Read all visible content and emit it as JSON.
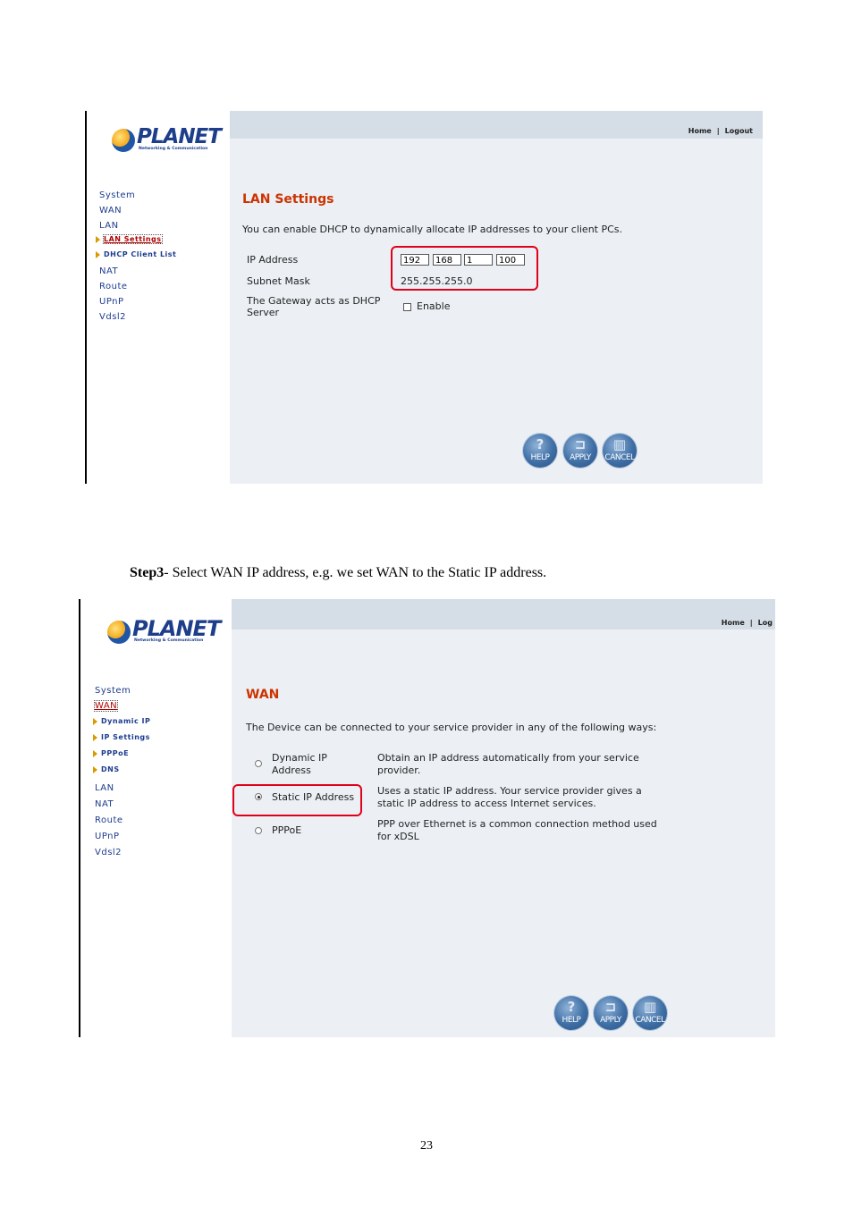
{
  "screen1": {
    "logo": {
      "word": "PLANET",
      "tagline": "Networking & Communication"
    },
    "top_links": {
      "home": "Home",
      "sep": "|",
      "logout": "Logout"
    },
    "nav": {
      "system": "System",
      "wan": "WAN",
      "lan": "LAN",
      "lan_settings": "LAN Settings",
      "dhcp_client_list": "DHCP Client List",
      "nat": "NAT",
      "route": "Route",
      "upnp": "UPnP",
      "vdsl2": "Vdsl2"
    },
    "title": "LAN Settings",
    "description": "You can enable DHCP to dynamically allocate IP addresses to your client PCs.",
    "ip_label": "IP Address",
    "ip": [
      "192",
      "168",
      "1",
      "100"
    ],
    "mask_label": "Subnet Mask",
    "mask_value": "255.255.255.0",
    "gateway_label_1": "The Gateway acts as DHCP",
    "gateway_label_2": "Server",
    "enable_label": "Enable",
    "buttons": {
      "help": "HELP",
      "apply": "APPLY",
      "cancel": "CANCEL"
    }
  },
  "step_text": {
    "bold": "Step3",
    "rest": "- Select WAN IP address, e.g. we set WAN to the Static IP address."
  },
  "screen2": {
    "logo": {
      "word": "PLANET",
      "tagline": "Networking & Communication"
    },
    "top_links": {
      "home": "Home",
      "sep": "|",
      "logout": "Log"
    },
    "nav": {
      "system": "System",
      "wan": "WAN",
      "dynamic_ip": "Dynamic IP",
      "ip_settings": "IP Settings",
      "pppoe": "PPPoE",
      "dns": "DNS",
      "lan": "LAN",
      "nat": "NAT",
      "route": "Route",
      "upnp": "UPnP",
      "vdsl2": "Vdsl2"
    },
    "title": "WAN",
    "description": "The Device can be connected to your service provider in any of the following ways:",
    "options": [
      {
        "label_1": "Dynamic IP",
        "label_2": "Address",
        "desc_1": "Obtain an IP address automatically from your service",
        "desc_2": "provider."
      },
      {
        "label_1": "Static IP Address",
        "label_2": "",
        "desc_1": "Uses a static IP address. Your service provider gives a",
        "desc_2": "static IP address to access Internet services."
      },
      {
        "label_1": "PPPoE",
        "label_2": "",
        "desc_1": "PPP over Ethernet is a common connection method used",
        "desc_2": "for xDSL"
      }
    ],
    "buttons": {
      "help": "HELP",
      "apply": "APPLY",
      "cancel": "CANCEL"
    }
  },
  "page_number": "23"
}
